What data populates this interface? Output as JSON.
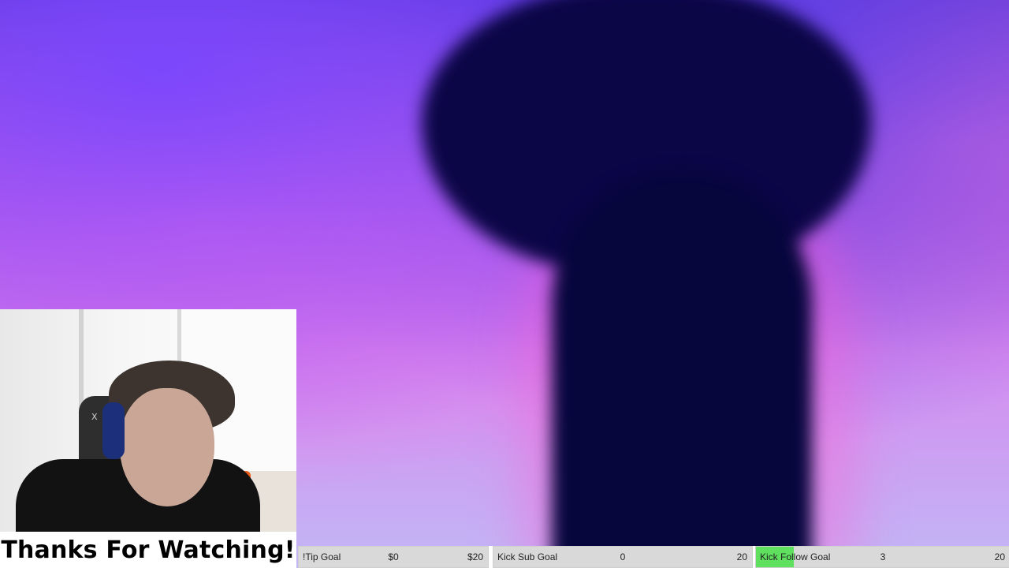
{
  "overlay": {
    "thanks_text": "Thanks For Watching!",
    "webcam_chair_logo": "X"
  },
  "goals": [
    {
      "label": "!Tip Goal",
      "current": "$0",
      "target": "$20",
      "progress": 0,
      "fill_color": "#5fe05f"
    },
    {
      "label": "Kick Sub Goal",
      "current": "0",
      "target": "20",
      "progress": 0,
      "fill_color": "#5fe05f"
    },
    {
      "label": "Kick Follow Goal",
      "current": "3",
      "target": "20",
      "progress": 0.15,
      "fill_color": "#5fe05f"
    }
  ],
  "colors": {
    "goal_bar_bg": "#d9d9d9",
    "goal_fill": "#5fe05f"
  }
}
